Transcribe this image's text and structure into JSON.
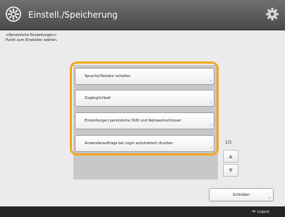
{
  "header": {
    "title": "Einstell./Speicherung",
    "app_icon": "settings-gear-circle-icon",
    "settings_icon": "gear-icon"
  },
  "instruction": {
    "line1": "<Persönliche Einstellungen>",
    "line2": "Punkt zum Einstellen wählen."
  },
  "list": {
    "items": [
      {
        "label": "Sprache/Tastatur schalten"
      },
      {
        "label": "Zugänglichkeit"
      },
      {
        "label": "Einstellungen persönliche SSID und Netzwerkschlüssel"
      },
      {
        "label": "Anwenderaufträge bei Login automatisch drucken"
      }
    ],
    "page_indicator": "1/1",
    "scroll_up_icon": "chevron-up-icon",
    "scroll_down_icon": "chevron-down-icon"
  },
  "close_label": "Schließen",
  "footer": {
    "logout_label": "Logout"
  },
  "colors": {
    "highlight": "#f2a51f",
    "header_bg": "#5a5a5a",
    "footer_bg": "#262626"
  }
}
